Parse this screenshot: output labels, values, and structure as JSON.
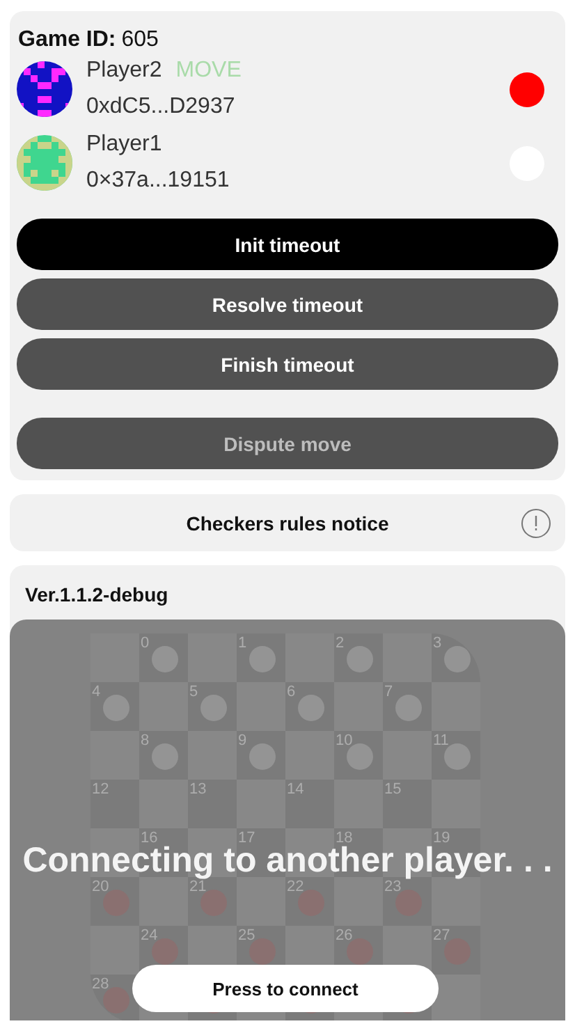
{
  "game": {
    "label": "Game ID:",
    "value": "605"
  },
  "players": [
    {
      "name": "Player2",
      "status": "MOVE",
      "address": "0xdC5...D2937",
      "color": "#ff0000"
    },
    {
      "name": "Player1",
      "address": "0×37a...19151",
      "color": "#ffffff"
    }
  ],
  "buttons": [
    {
      "label": "Init timeout",
      "kind": "primary",
      "disabled": false
    },
    {
      "label": "Resolve timeout",
      "kind": "secondary",
      "disabled": false
    },
    {
      "label": "Finish timeout",
      "kind": "secondary",
      "disabled": false
    },
    {
      "label": "Dispute move",
      "kind": "separated",
      "disabled": true
    }
  ],
  "notice": {
    "label": "Checkers rules notice"
  },
  "version": "Ver.1.1.2-debug",
  "board": {
    "cells": [
      {
        "label": "0",
        "kind": "light"
      },
      {
        "label": "1",
        "kind": "light"
      },
      {
        "label": "2",
        "kind": "light"
      },
      {
        "label": "3",
        "kind": "light"
      },
      {
        "label": "4",
        "kind": "light"
      },
      {
        "label": "5",
        "kind": "light"
      },
      {
        "label": "6",
        "kind": "light"
      },
      {
        "label": "7",
        "kind": "light"
      },
      {
        "label": "8",
        "kind": "light"
      },
      {
        "label": "9",
        "kind": "light"
      },
      {
        "label": "10",
        "kind": "light"
      },
      {
        "label": "11",
        "kind": "light"
      },
      {
        "label": "12",
        "kind": "empty"
      },
      {
        "label": "13",
        "kind": "empty"
      },
      {
        "label": "14",
        "kind": "empty"
      },
      {
        "label": "15",
        "kind": "empty"
      },
      {
        "label": "16",
        "kind": "empty"
      },
      {
        "label": "17",
        "kind": "empty"
      },
      {
        "label": "18",
        "kind": "empty"
      },
      {
        "label": "19",
        "kind": "empty"
      },
      {
        "label": "20",
        "kind": "red"
      },
      {
        "label": "21",
        "kind": "red"
      },
      {
        "label": "22",
        "kind": "red"
      },
      {
        "label": "23",
        "kind": "red"
      },
      {
        "label": "24",
        "kind": "red"
      },
      {
        "label": "25",
        "kind": "red"
      },
      {
        "label": "26",
        "kind": "red"
      },
      {
        "label": "27",
        "kind": "red"
      },
      {
        "label": "28",
        "kind": "red"
      },
      {
        "kind": "red"
      },
      {
        "kind": "red"
      },
      {
        "kind": "red"
      }
    ],
    "overlay": {
      "message": "Connecting to another player. . .",
      "button": "Press to connect"
    }
  }
}
